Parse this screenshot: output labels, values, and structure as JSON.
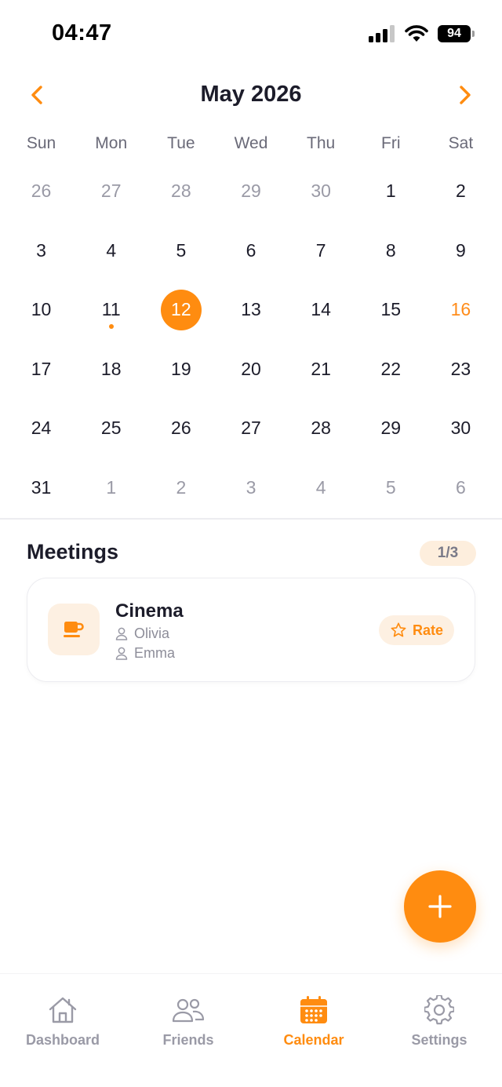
{
  "status_bar": {
    "time": "04:47",
    "battery": "94"
  },
  "calendar": {
    "month_title": "May 2026",
    "weekdays": [
      "Sun",
      "Mon",
      "Tue",
      "Wed",
      "Thu",
      "Fri",
      "Sat"
    ],
    "days": [
      {
        "label": "26",
        "muted": true
      },
      {
        "label": "27",
        "muted": true
      },
      {
        "label": "28",
        "muted": true
      },
      {
        "label": "29",
        "muted": true
      },
      {
        "label": "30",
        "muted": true
      },
      {
        "label": "1"
      },
      {
        "label": "2"
      },
      {
        "label": "3"
      },
      {
        "label": "4"
      },
      {
        "label": "5"
      },
      {
        "label": "6"
      },
      {
        "label": "7"
      },
      {
        "label": "8"
      },
      {
        "label": "9"
      },
      {
        "label": "10"
      },
      {
        "label": "11",
        "event": true
      },
      {
        "label": "12",
        "selected": true
      },
      {
        "label": "13"
      },
      {
        "label": "14"
      },
      {
        "label": "15"
      },
      {
        "label": "16",
        "accent": true
      },
      {
        "label": "17"
      },
      {
        "label": "18"
      },
      {
        "label": "19"
      },
      {
        "label": "20"
      },
      {
        "label": "21"
      },
      {
        "label": "22"
      },
      {
        "label": "23"
      },
      {
        "label": "24"
      },
      {
        "label": "25"
      },
      {
        "label": "26"
      },
      {
        "label": "27"
      },
      {
        "label": "28"
      },
      {
        "label": "29"
      },
      {
        "label": "30"
      },
      {
        "label": "31"
      },
      {
        "label": "1",
        "muted": true
      },
      {
        "label": "2",
        "muted": true
      },
      {
        "label": "3",
        "muted": true
      },
      {
        "label": "4",
        "muted": true
      },
      {
        "label": "5",
        "muted": true
      },
      {
        "label": "6",
        "muted": true
      }
    ]
  },
  "meetings": {
    "title": "Meetings",
    "pager": "1/3",
    "cards": [
      {
        "name": "Cinema",
        "icon": "coffee-cup-icon",
        "participants": [
          "Olivia",
          "Emma"
        ],
        "rate_label": "Rate"
      }
    ]
  },
  "tab_bar": {
    "tabs": [
      {
        "label": "Dashboard",
        "icon": "home-icon"
      },
      {
        "label": "Friends",
        "icon": "friends-icon"
      },
      {
        "label": "Calendar",
        "icon": "calendar-icon",
        "active": true
      },
      {
        "label": "Settings",
        "icon": "gear-icon"
      }
    ]
  },
  "colors": {
    "accent": "#ff8c10",
    "muted_text": "#9a9aa6",
    "primary_text": "#1c1c2a",
    "accent_soft": "#fdf0e2"
  }
}
